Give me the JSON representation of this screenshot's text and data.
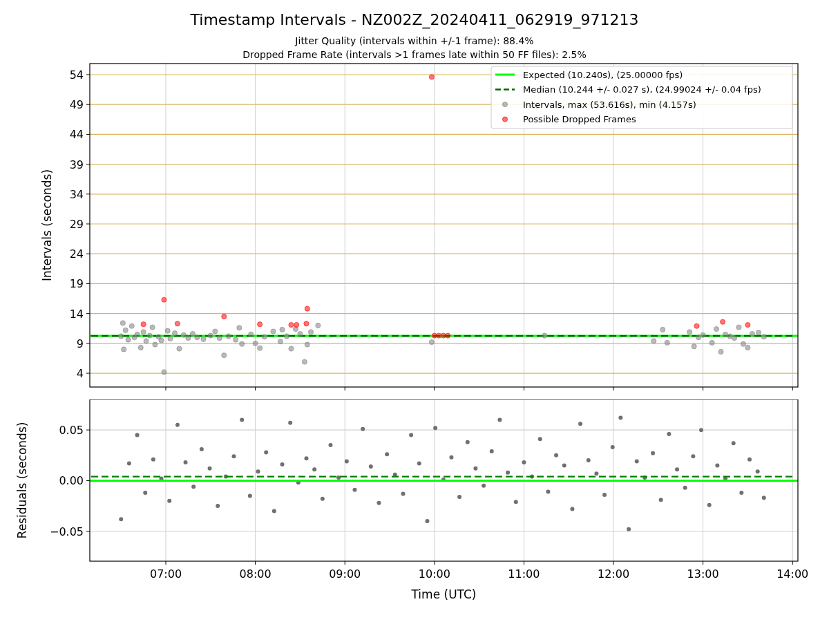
{
  "figure": {
    "title": "Timestamp Intervals - NZ002Z_20240411_062919_971213",
    "subtitles": [
      "Jitter Quality (intervals within +/-1 frame): 88.4%",
      "Dropped Frame Rate (intervals >1 frames late within 50 FF files): 2.5%"
    ],
    "panels": [
      {
        "chart_data": {
          "type": "scatter",
          "ylabel": "Intervals (seconds)",
          "grid": true,
          "legend": true,
          "xlim": [
            6.151,
            14.06
          ],
          "ylim": [
            1.69,
            55.85
          ],
          "yticks": [
            {
              "value": 4,
              "label": "4"
            },
            {
              "value": 9,
              "label": "9"
            },
            {
              "value": 14,
              "label": "14"
            },
            {
              "value": 19,
              "label": "19"
            },
            {
              "value": 24,
              "label": "24"
            },
            {
              "value": 29,
              "label": "29"
            },
            {
              "value": 34,
              "label": "34"
            },
            {
              "value": 39,
              "label": "39"
            },
            {
              "value": 44,
              "label": "44"
            },
            {
              "value": 49,
              "label": "49"
            },
            {
              "value": 54,
              "label": "54"
            }
          ],
          "series": [
            {
              "name": "Expected (10.240s), (25.00000 fps)",
              "type": "line",
              "line_style": "solid",
              "color": "#00ff00",
              "x": [
                6.151,
                14.06
              ],
              "values": [
                10.24,
                10.24
              ]
            },
            {
              "name": "Median (10.244 +/- 0.027 s), (24.99024 +/- 0.04 fps)",
              "type": "line",
              "line_style": "dashed",
              "color": "#006400",
              "x": [
                6.151,
                14.06
              ],
              "values": [
                10.244,
                10.244
              ]
            },
            {
              "name": "Intervals, max (53.616s), min (4.157s)",
              "type": "scatter",
              "color": "#808080",
              "x": [
                6.5,
                6.52,
                6.53,
                6.55,
                6.58,
                6.62,
                6.65,
                6.68,
                6.72,
                6.75,
                6.78,
                6.82,
                6.85,
                6.88,
                6.92,
                6.95,
                6.98,
                7.02,
                7.05,
                7.1,
                7.15,
                7.2,
                7.25,
                7.3,
                7.35,
                7.42,
                7.5,
                7.55,
                7.6,
                7.65,
                7.7,
                7.78,
                7.82,
                7.85,
                7.95,
                8.0,
                8.05,
                8.1,
                8.2,
                8.28,
                8.3,
                8.35,
                8.4,
                8.45,
                8.5,
                8.55,
                8.58,
                8.62,
                8.7,
                9.97,
                11.23,
                12.45,
                12.55,
                12.6,
                12.85,
                12.9,
                12.95,
                13.0,
                13.1,
                13.15,
                13.2,
                13.25,
                13.3,
                13.35,
                13.4,
                13.45,
                13.5,
                13.55,
                13.62,
                13.68
              ],
              "values": [
                10.2,
                12.4,
                8.0,
                11.2,
                9.6,
                11.9,
                10.0,
                10.5,
                8.3,
                10.9,
                9.4,
                10.3,
                11.7,
                8.8,
                10.1,
                9.5,
                4.2,
                11.1,
                9.8,
                10.7,
                8.1,
                10.4,
                9.9,
                10.6,
                10.0,
                9.7,
                10.3,
                11.0,
                9.9,
                7.0,
                10.2,
                9.6,
                11.6,
                8.9,
                10.5,
                9.0,
                8.2,
                10.1,
                11.0,
                9.3,
                11.3,
                10.2,
                8.1,
                11.4,
                10.6,
                5.9,
                8.8,
                10.9,
                12.0,
                9.2,
                10.3,
                9.4,
                11.3,
                9.1,
                10.9,
                8.5,
                10.0,
                10.4,
                9.1,
                11.4,
                7.6,
                10.5,
                10.2,
                9.9,
                11.7,
                8.9,
                8.3,
                10.6,
                10.8,
                10.1
              ]
            },
            {
              "name": "Possible Dropped Frames",
              "type": "scatter",
              "color": "#ff0000",
              "x": [
                6.75,
                6.98,
                7.13,
                7.65,
                8.05,
                8.4,
                8.46,
                8.57,
                8.58,
                9.97,
                10.0,
                10.05,
                10.1,
                10.15,
                12.93,
                13.22,
                13.5
              ],
              "values": [
                12.2,
                16.3,
                12.3,
                13.5,
                12.2,
                12.1,
                12.1,
                12.3,
                14.8,
                53.6,
                10.3,
                10.3,
                10.3,
                10.3,
                11.9,
                12.6,
                12.1
              ]
            }
          ]
        }
      },
      {
        "chart_data": {
          "type": "scatter",
          "grid": true,
          "xlabel": "Time (UTC)",
          "ylabel": "Residuals (seconds)",
          "xlim": [
            6.151,
            14.06
          ],
          "ylim": [
            -0.0795,
            0.0801
          ],
          "xticks": [
            {
              "value": 7,
              "label": "07:00"
            },
            {
              "value": 8,
              "label": "08:00"
            },
            {
              "value": 9,
              "label": "09:00"
            },
            {
              "value": 10,
              "label": "10:00"
            },
            {
              "value": 11,
              "label": "11:00"
            },
            {
              "value": 12,
              "label": "12:00"
            },
            {
              "value": 13,
              "label": "13:00"
            },
            {
              "value": 14,
              "label": "14:00"
            }
          ],
          "yticks": [
            {
              "value": -0.05,
              "label": "−0.05"
            },
            {
              "value": 0,
              "label": "0.00"
            },
            {
              "value": 0.05,
              "label": "0.05"
            }
          ],
          "series": [
            {
              "type": "scatter",
              "color": "#707070",
              "x": [
                6.5,
                6.59,
                6.68,
                6.77,
                6.86,
                6.95,
                7.04,
                7.13,
                7.22,
                7.31,
                7.4,
                7.49,
                7.58,
                7.67,
                7.76,
                7.85,
                7.94,
                8.03,
                8.12,
                8.21,
                8.3,
                8.39,
                8.48,
                8.57,
                8.66,
                8.75,
                8.84,
                8.93,
                9.02,
                9.11,
                9.2,
                9.29,
                9.38,
                9.47,
                9.56,
                9.65,
                9.74,
                9.83,
                9.92,
                10.01,
                10.1,
                10.19,
                10.28,
                10.37,
                10.46,
                10.55,
                10.64,
                10.73,
                10.82,
                10.91,
                11.0,
                11.09,
                11.18,
                11.27,
                11.36,
                11.45,
                11.54,
                11.63,
                11.72,
                11.81,
                11.9,
                11.99,
                12.08,
                12.17,
                12.26,
                12.35,
                12.44,
                12.53,
                12.62,
                12.71,
                12.8,
                12.89,
                12.98,
                13.07,
                13.16,
                13.25,
                13.34,
                13.43,
                13.52,
                13.61,
                13.68
              ],
              "values": [
                -0.038,
                0.017,
                0.045,
                -0.012,
                0.021,
                0.002,
                -0.02,
                0.055,
                0.018,
                -0.006,
                0.031,
                0.012,
                -0.025,
                0.004,
                0.024,
                0.06,
                -0.015,
                0.009,
                0.028,
                -0.03,
                0.016,
                0.057,
                -0.002,
                0.022,
                0.011,
                -0.018,
                0.035,
                0.003,
                0.019,
                -0.009,
                0.051,
                0.014,
                -0.022,
                0.026,
                0.006,
                -0.013,
                0.045,
                0.017,
                -0.04,
                0.052,
                0.001,
                0.023,
                -0.016,
                0.038,
                0.012,
                -0.005,
                0.029,
                0.06,
                0.008,
                -0.021,
                0.018,
                0.004,
                0.041,
                -0.011,
                0.025,
                0.015,
                -0.028,
                0.056,
                0.02,
                0.007,
                -0.014,
                0.033,
                0.062,
                -0.048,
                0.019,
                0.003,
                0.027,
                -0.019,
                0.046,
                0.011,
                -0.007,
                0.024,
                0.05,
                -0.024,
                0.015,
                0.002,
                0.037,
                -0.012,
                0.021,
                0.009,
                -0.017
              ]
            },
            {
              "type": "line",
              "line_style": "solid",
              "color": "#00ff00",
              "x": [
                6.151,
                14.06
              ],
              "values": [
                0,
                0
              ]
            },
            {
              "type": "line",
              "line_style": "dashed",
              "color": "#008000",
              "x": [
                6.151,
                14.06
              ],
              "values": [
                0.004,
                0.004
              ]
            }
          ]
        }
      }
    ]
  }
}
